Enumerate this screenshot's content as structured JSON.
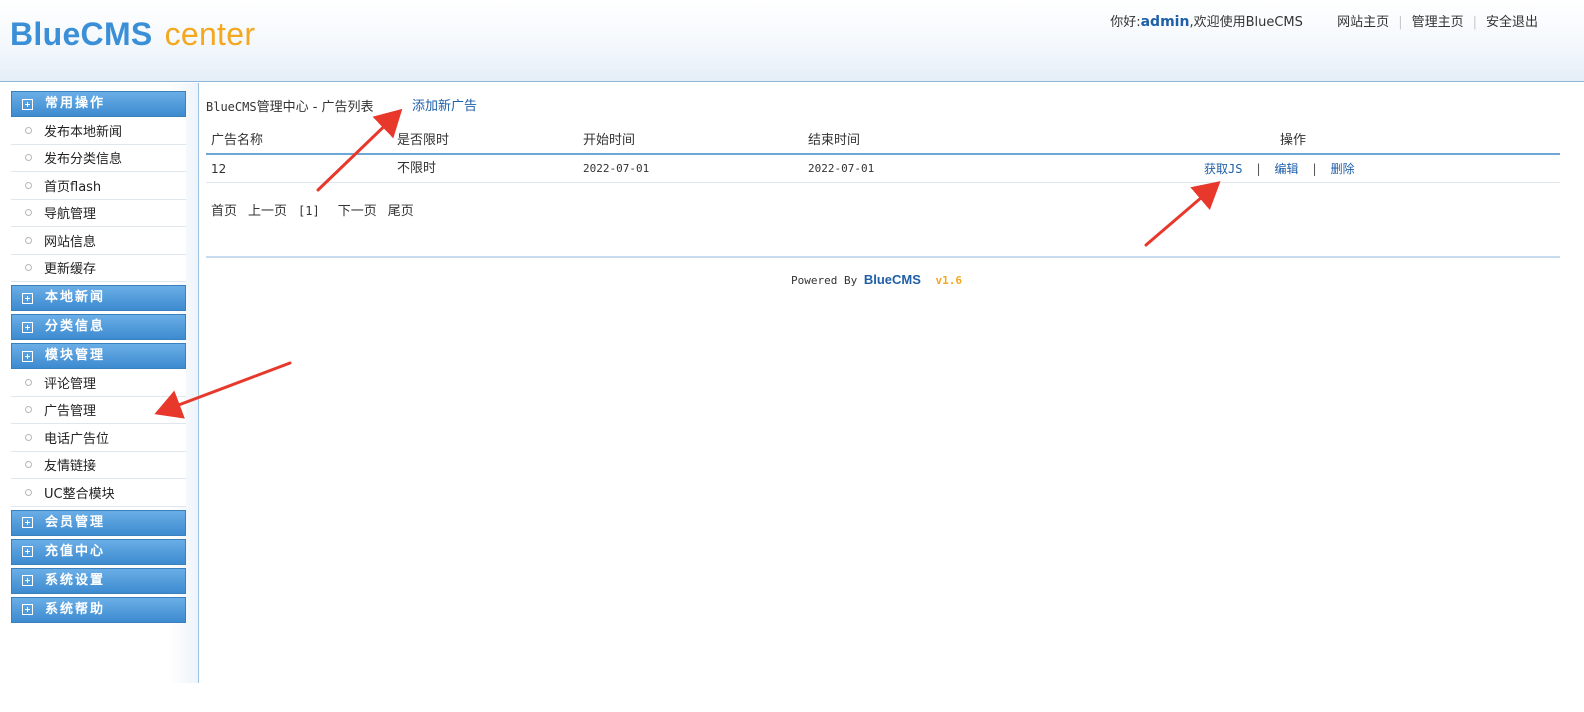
{
  "header": {
    "logo_main": "BlueCMS",
    "logo_sub": "center",
    "greeting_prefix": "你好:",
    "username": "admin",
    "greeting_suffix": ",欢迎使用BlueCMS",
    "links": [
      "网站主页",
      "管理主页",
      "安全退出"
    ],
    "link_separator": "|"
  },
  "sidebar": {
    "groups": [
      {
        "label": "常用操作",
        "items": [
          "发布本地新闻",
          "发布分类信息",
          "首页flash",
          "导航管理",
          "网站信息",
          "更新缓存"
        ]
      },
      {
        "label": "本地新闻",
        "items": []
      },
      {
        "label": "分类信息",
        "items": []
      },
      {
        "label": "模块管理",
        "items": [
          "评论管理",
          "广告管理",
          "电话广告位",
          "友情链接",
          "UC整合模块"
        ]
      },
      {
        "label": "会员管理",
        "items": []
      },
      {
        "label": "充值中心",
        "items": []
      },
      {
        "label": "系统设置",
        "items": []
      },
      {
        "label": "系统帮助",
        "items": []
      }
    ]
  },
  "main": {
    "breadcrumb_prefix": "BlueCMS",
    "breadcrumb_rest": "管理中心 - 广告列表",
    "add_link": "添加新广告",
    "table": {
      "headers": [
        "广告名称",
        "是否限时",
        "开始时间",
        "结束时间",
        "操作"
      ],
      "rows": [
        {
          "name": "12",
          "limited": "不限时",
          "start": "2022-07-01",
          "end": "2022-07-01",
          "actions": [
            "获取JS",
            "编辑",
            "删除"
          ]
        }
      ],
      "action_separator": "|"
    },
    "pager": {
      "first": "首页",
      "prev": "上一页",
      "current": "[1]",
      "next": "下一页",
      "last": "尾页"
    },
    "footer": {
      "powered_by": "Powered By",
      "brand": "BlueCMS",
      "version": "v1.6"
    }
  },
  "colors": {
    "accent_blue": "#3a8fd6",
    "logo_orange": "#f3a81f",
    "link_blue": "#1f5fa8",
    "arrow_red": "#e8382b"
  }
}
